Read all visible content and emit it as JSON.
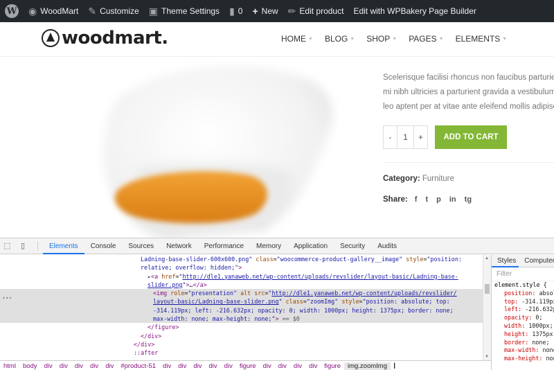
{
  "admin_bar": {
    "items": [
      {
        "label": "WoodMart",
        "icon": "dashboard-icon"
      },
      {
        "label": "Customize",
        "icon": "brush-icon"
      },
      {
        "label": "Theme Settings",
        "icon": "folder-icon"
      },
      {
        "label": "0",
        "icon": "comment-icon"
      },
      {
        "label": "New",
        "icon": "plus-icon"
      },
      {
        "label": "Edit product",
        "icon": "pencil-icon"
      },
      {
        "label": "Edit with WPBakery Page Builder",
        "icon": ""
      }
    ]
  },
  "site": {
    "logo_text": "woodmart.",
    "nav": [
      "HOME",
      "BLOG",
      "SHOP",
      "PAGES",
      "ELEMENTS"
    ]
  },
  "product": {
    "description_lines": [
      "Scelerisque facilisi rhoncus non faucibus parturient",
      "mi nibh ultricies a parturient gravida a vestibulum",
      "leo aptent per at vitae ante eleifend mollis adipisci"
    ],
    "quantity": "1",
    "minus": "-",
    "plus": "+",
    "add_to_cart": "ADD TO CART",
    "category_label": "Category:",
    "category_value": "Furniture",
    "share_label": "Share:",
    "share_icons": [
      "f",
      "t",
      "p",
      "in",
      "tg"
    ]
  },
  "devtools": {
    "tabs": [
      "Elements",
      "Console",
      "Sources",
      "Network",
      "Performance",
      "Memory",
      "Application",
      "Security",
      "Audits"
    ],
    "active_tab": "Elements",
    "side_tabs": [
      "Styles",
      "Computed"
    ],
    "filter_placeholder": "Filter",
    "element_style_rule": "element.style {",
    "style_props": [
      {
        "p": "position:",
        "v": "absolute;"
      },
      {
        "p": "top:",
        "v": "-314.119px;"
      },
      {
        "p": "left:",
        "v": "-216.632px;"
      },
      {
        "p": "opacity:",
        "v": "0;"
      },
      {
        "p": "width:",
        "v": "1000px;"
      },
      {
        "p": "height:",
        "v": "1375px;"
      },
      {
        "p": "border:",
        "v": "none;"
      },
      {
        "p": "max-width:",
        "v": "none;"
      },
      {
        "p": "max-height:",
        "v": "none;"
      }
    ],
    "breadcrumbs": [
      "html",
      "body",
      "div",
      "div",
      "div",
      "div",
      "div",
      "#product-51",
      "div",
      "div",
      "div",
      "div",
      "div",
      "figure",
      "div",
      "div",
      "div",
      "div",
      "figure",
      "img.zoomImg"
    ]
  }
}
